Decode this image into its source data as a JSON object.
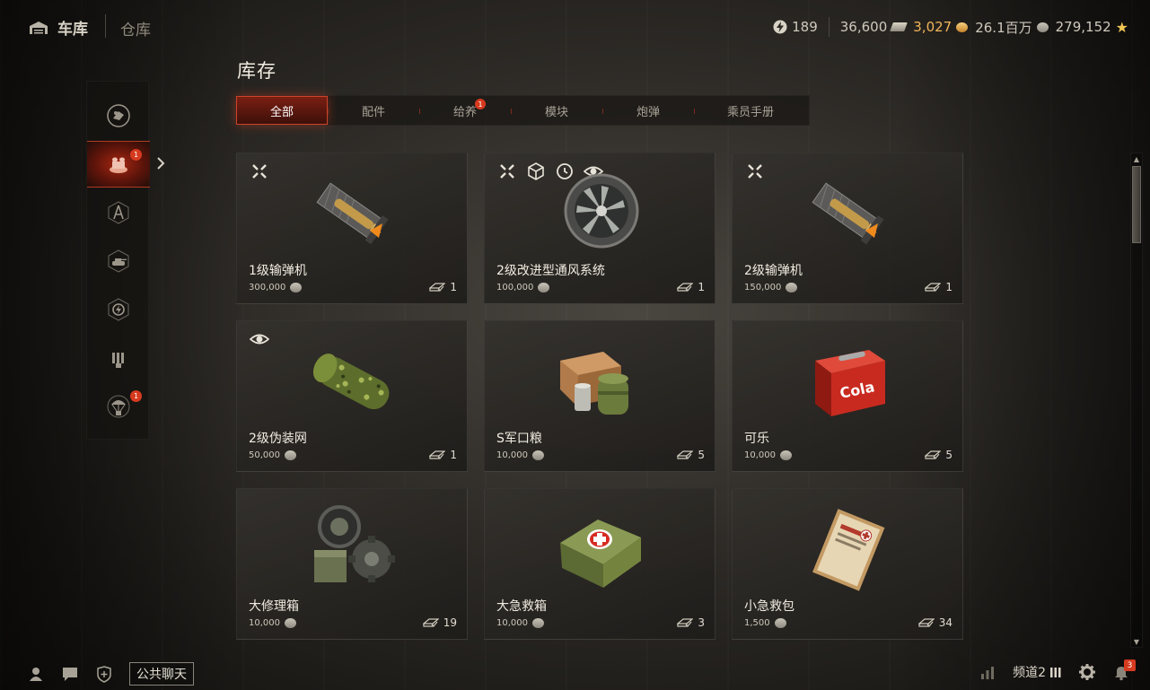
{
  "header": {
    "garage_label": "车库",
    "warehouse_label": "仓库",
    "currencies": {
      "free_xp": "189",
      "bonds": "36,600",
      "gold": "3,027",
      "credits": "26.1百万",
      "xp": "279,152"
    }
  },
  "page_title": "库存",
  "tabs": [
    {
      "label": "全部",
      "active": true
    },
    {
      "label": "配件"
    },
    {
      "label": "给养",
      "badge": "1"
    },
    {
      "label": "模块"
    },
    {
      "label": "炮弹"
    },
    {
      "label": "乘员手册"
    }
  ],
  "sidebar": {
    "items": [
      {
        "icon": "equipment-icon"
      },
      {
        "icon": "consumables-icon",
        "badge": "1",
        "active": true
      },
      {
        "icon": "modules-icon"
      },
      {
        "icon": "tank-icon"
      },
      {
        "icon": "boosters-icon"
      },
      {
        "icon": "shells-icon"
      },
      {
        "icon": "supply-drop-icon",
        "badge": "1"
      }
    ]
  },
  "items": [
    {
      "name": "1级输弹机",
      "price": "300,000",
      "count": "1",
      "flags": [
        "upgrade-icon"
      ],
      "art": "rammer"
    },
    {
      "name": "2级改进型通风系统",
      "price": "100,000",
      "count": "1",
      "flags": [
        "upgrade-icon",
        "cube-icon",
        "reload-icon",
        "eye-icon"
      ],
      "art": "ventilation"
    },
    {
      "name": "2级输弹机",
      "price": "150,000",
      "count": "1",
      "flags": [
        "upgrade-icon"
      ],
      "art": "rammer"
    },
    {
      "name": "2级伪装网",
      "price": "50,000",
      "count": "1",
      "flags": [
        "eye-icon"
      ],
      "art": "camo-net"
    },
    {
      "name": "S军口粮",
      "price": "10,000",
      "count": "5",
      "flags": [],
      "art": "rations"
    },
    {
      "name": "可乐",
      "price": "10,000",
      "count": "5",
      "flags": [],
      "art": "cola"
    },
    {
      "name": "大修理箱",
      "price": "10,000",
      "count": "19",
      "flags": [],
      "art": "repair-kit"
    },
    {
      "name": "大急救箱",
      "price": "10,000",
      "count": "3",
      "flags": [],
      "art": "first-aid-large"
    },
    {
      "name": "小急救包",
      "price": "1,500",
      "count": "34",
      "flags": [],
      "art": "first-aid-small"
    }
  ],
  "cola_label": "Cola",
  "bottom": {
    "chat_label": "公共聊天",
    "channel_label": "频道2",
    "notifications": "3"
  }
}
